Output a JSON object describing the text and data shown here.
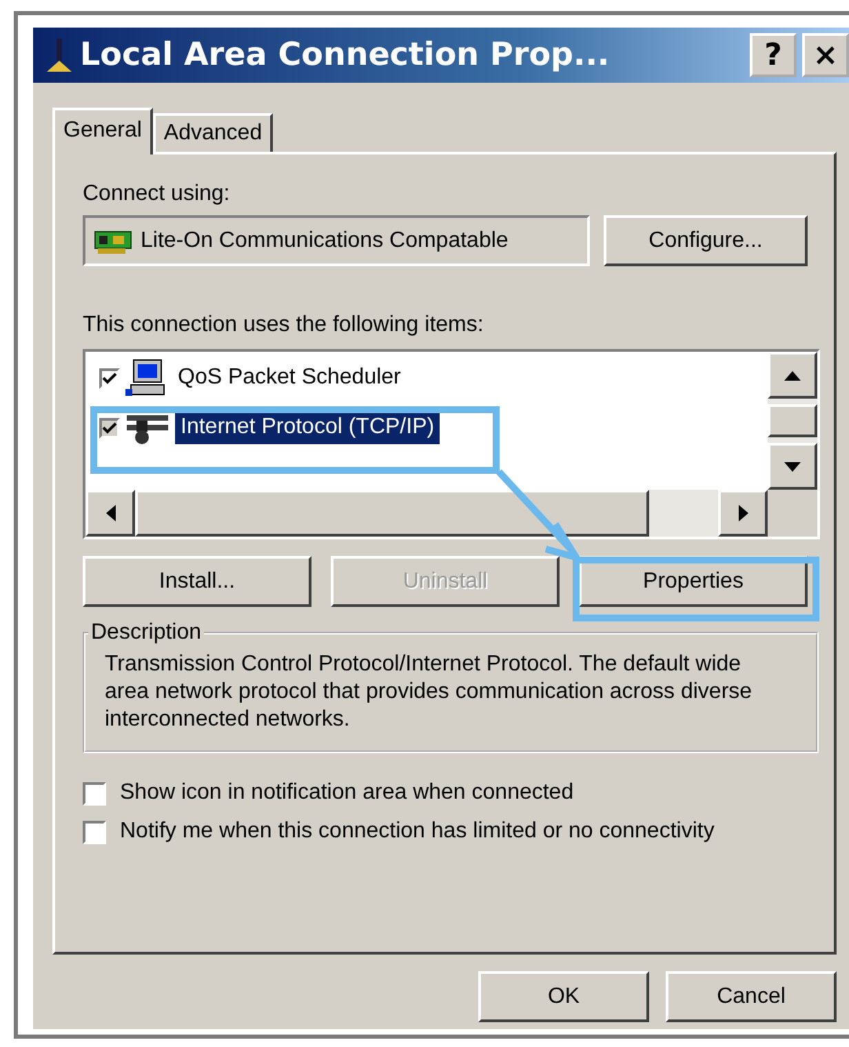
{
  "window": {
    "title": "Local Area Connection Prop...",
    "help": "?",
    "close": "×"
  },
  "tabs": [
    {
      "label": "General",
      "selected": true
    },
    {
      "label": "Advanced",
      "selected": false
    }
  ],
  "connect_using": {
    "label": "Connect using:",
    "adapter": "Lite-On Communications Compatable",
    "button": "Configure..."
  },
  "items": {
    "label": "This connection uses the following items:",
    "list": [
      {
        "kind": "service",
        "name": "QoS Packet Scheduler",
        "checked": true,
        "selected": false,
        "highlighted": false
      },
      {
        "kind": "protocol",
        "name": "Internet Protocol (TCP/IP)",
        "checked": true,
        "selected": true,
        "highlighted": true
      }
    ]
  },
  "item_buttons": [
    {
      "label": "Install...",
      "disabled": false,
      "highlighted": false
    },
    {
      "label": "Uninstall",
      "disabled": true,
      "highlighted": false
    },
    {
      "label": "Properties",
      "disabled": false,
      "highlighted": true
    }
  ],
  "description": {
    "title": "Description",
    "text": "Transmission Control Protocol/Internet Protocol. The default wide area network protocol that provides communication across diverse interconnected networks."
  },
  "options": [
    {
      "label": "Show icon in notification area when connected",
      "checked": false
    },
    {
      "label": "Notify me when this connection has limited or no connectivity",
      "checked": false
    }
  ],
  "footer_buttons": [
    "OK",
    "Cancel"
  ]
}
